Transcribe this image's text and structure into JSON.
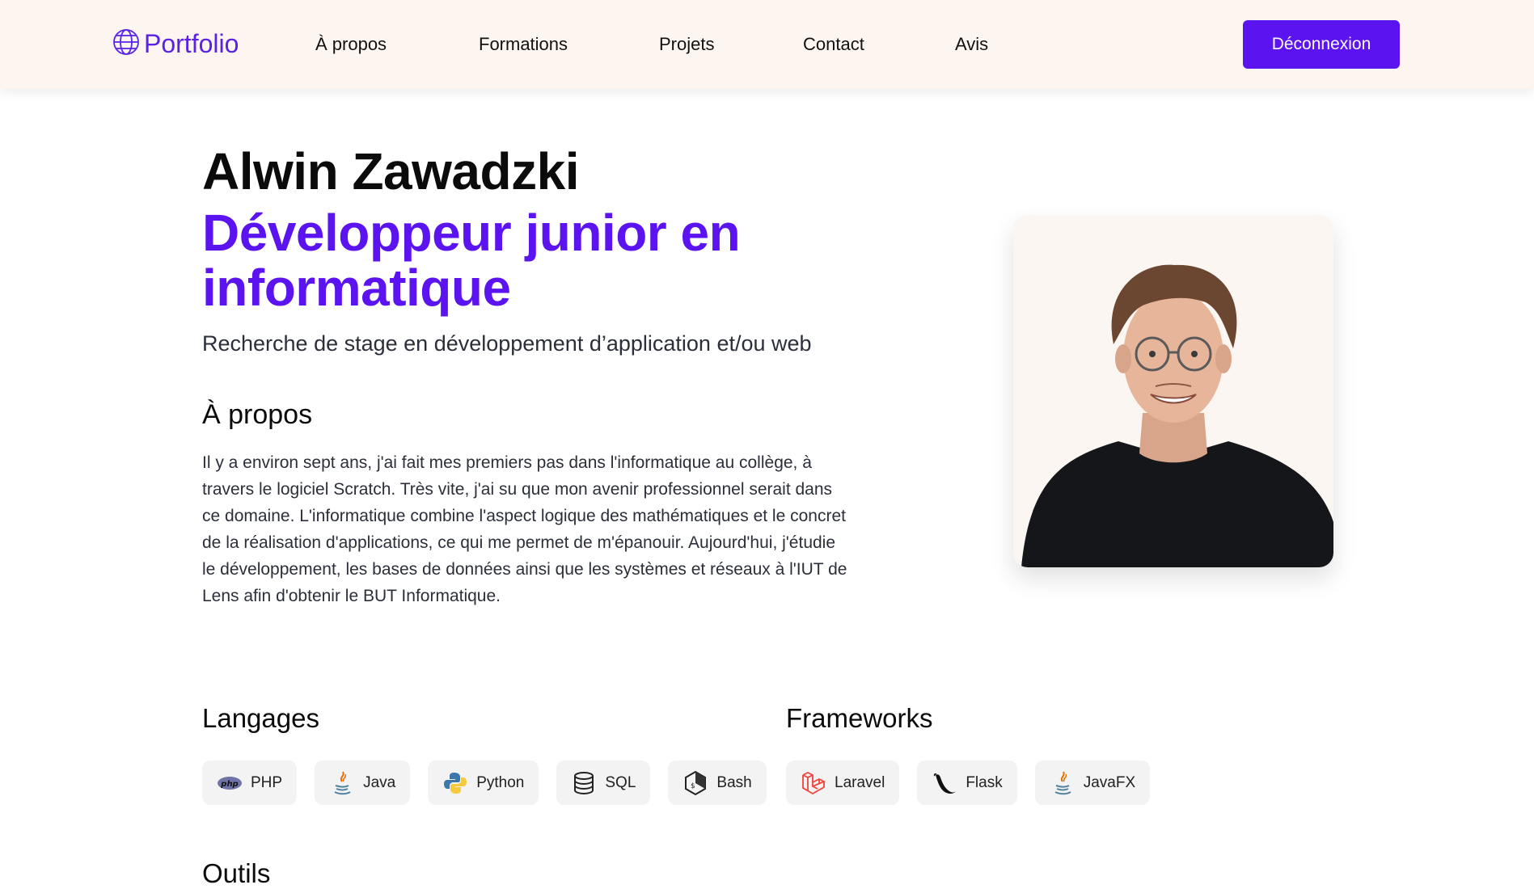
{
  "nav": {
    "brand": "Portfolio",
    "links": [
      "À propos",
      "Formations",
      "Projets",
      "Contact",
      "Avis"
    ],
    "logout_label": "Déconnexion"
  },
  "hero": {
    "name": "Alwin Zawadzki",
    "role": "Développeur junior en informatique",
    "tagline": "Recherche de stage en développement d’application et/ou web"
  },
  "about": {
    "title": "À propos",
    "text": "Il y a environ sept ans, j'ai fait mes premiers pas dans l'informatique au collège, à travers le logiciel Scratch. Très vite, j'ai su que mon avenir professionnel serait dans ce domaine. L'informatique combine l'aspect logique des mathématiques et le concret de la réalisation d'applications, ce qui me permet de m'épanouir. Aujourd'hui, j'étudie le développement, les bases de données ainsi que les systèmes et réseaux à l'IUT de Lens afin d'obtenir le BUT Informatique."
  },
  "skills": {
    "languages": {
      "title": "Langages",
      "items": [
        {
          "label": "PHP",
          "icon": "php-icon"
        },
        {
          "label": "Java",
          "icon": "java-icon"
        },
        {
          "label": "Python",
          "icon": "python-icon"
        },
        {
          "label": "SQL",
          "icon": "database-icon"
        },
        {
          "label": "Bash",
          "icon": "bash-icon"
        }
      ]
    },
    "frameworks": {
      "title": "Frameworks",
      "items": [
        {
          "label": "Laravel",
          "icon": "laravel-icon"
        },
        {
          "label": "Flask",
          "icon": "flask-icon"
        },
        {
          "label": "JavaFX",
          "icon": "java-icon"
        }
      ]
    },
    "next_title": "Outils"
  },
  "colors": {
    "accent": "#5b13f0",
    "navbar_bg": "#fdf6f0",
    "chip_bg": "#f3f3f4"
  }
}
